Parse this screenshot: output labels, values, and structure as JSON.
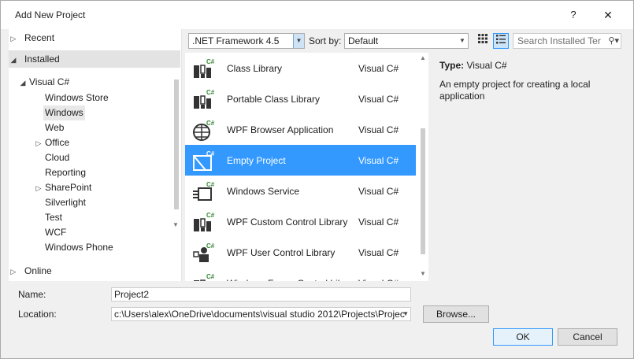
{
  "dialog": {
    "title": "Add New Project",
    "help_glyph": "?",
    "close_glyph": "✕"
  },
  "tree": {
    "recent": "Recent",
    "installed": "Installed",
    "visual_csharp": "Visual C#",
    "children": [
      "Windows Store",
      "Windows",
      "Web",
      "Office",
      "Cloud",
      "Reporting",
      "SharePoint",
      "Silverlight",
      "Test",
      "WCF",
      "Windows Phone"
    ],
    "online": "Online"
  },
  "toolbar": {
    "framework": ".NET Framework 4.5",
    "sort_label": "Sort by:",
    "sort_value": "Default",
    "search_placeholder": "Search Installed Ter"
  },
  "templates": [
    {
      "name": "Class Library",
      "lang": "Visual C#",
      "icon": "class-library-icon"
    },
    {
      "name": "Portable Class Library",
      "lang": "Visual C#",
      "icon": "portable-class-library-icon"
    },
    {
      "name": "WPF Browser Application",
      "lang": "Visual C#",
      "icon": "wpf-browser-icon"
    },
    {
      "name": "Empty Project",
      "lang": "Visual C#",
      "icon": "empty-project-icon",
      "selected": true
    },
    {
      "name": "Windows Service",
      "lang": "Visual C#",
      "icon": "windows-service-icon"
    },
    {
      "name": "WPF Custom Control Library",
      "lang": "Visual C#",
      "icon": "wpf-custom-control-icon"
    },
    {
      "name": "WPF User Control Library",
      "lang": "Visual C#",
      "icon": "wpf-user-control-icon"
    },
    {
      "name": "Windows Forms Control Library",
      "lang": "Visual C#",
      "icon": "windows-forms-control-icon"
    }
  ],
  "info": {
    "type_label": "Type:",
    "type_value": "Visual C#",
    "description": "An empty project for creating a local application"
  },
  "form": {
    "name_label": "Name:",
    "name_value": "Project2",
    "location_label": "Location:",
    "location_value": "c:\\Users\\alex\\OneDrive\\documents\\visual studio 2012\\Projects\\Projec",
    "browse_label": "Browse...",
    "ok_label": "OK",
    "cancel_label": "Cancel"
  },
  "colors": {
    "selection": "#3399ff",
    "csharp_badge": "#388a34"
  }
}
